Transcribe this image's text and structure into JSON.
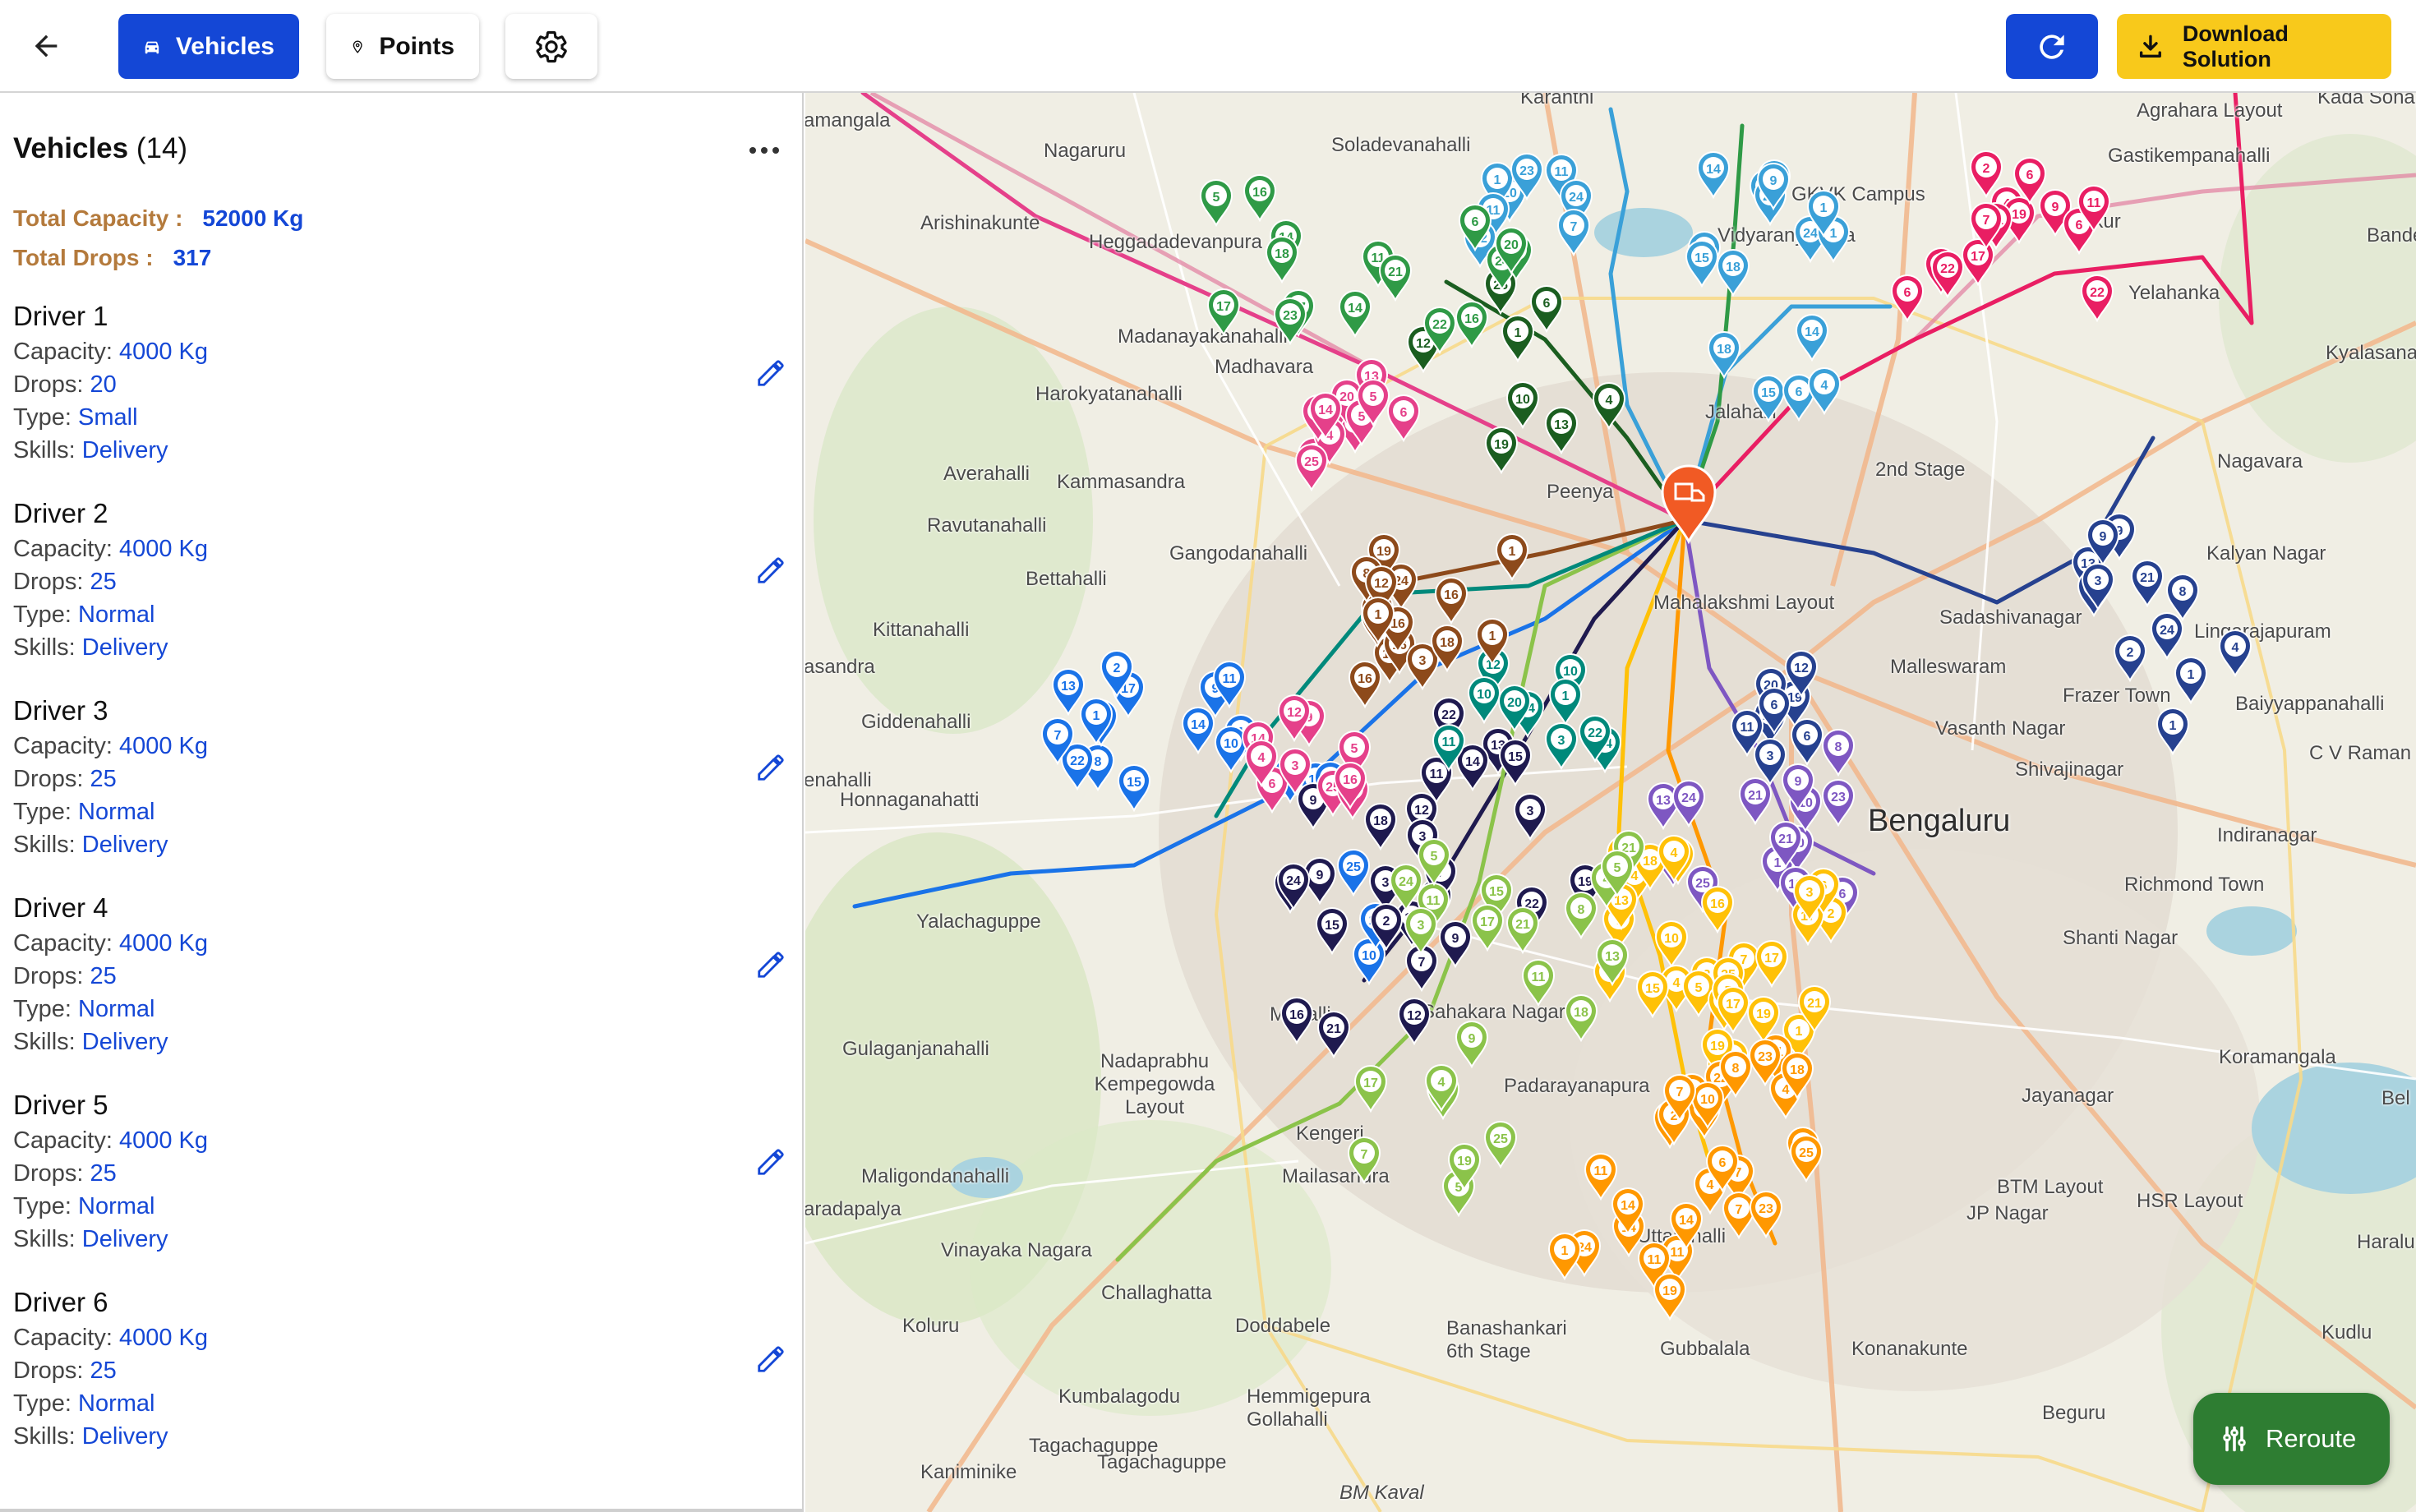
{
  "header": {
    "tabs": [
      {
        "label": "Vehicles",
        "active": true
      },
      {
        "label": "Points",
        "active": false
      }
    ],
    "download_label": "Download Solution"
  },
  "sidebar": {
    "title": "Vehicles",
    "count": "(14)",
    "total_capacity_label": "Total Capacity :",
    "total_capacity_value": "52000 Kg",
    "total_drops_label": "Total Drops :",
    "total_drops_value": "317",
    "field_labels": {
      "capacity": "Capacity: ",
      "drops": "Drops: ",
      "type": "Type: ",
      "skills": "Skills: "
    },
    "drivers": [
      {
        "name": "Driver 1",
        "capacity": "4000 Kg",
        "drops": "20",
        "type": "Small",
        "skills": "Delivery"
      },
      {
        "name": "Driver 2",
        "capacity": "4000 Kg",
        "drops": "25",
        "type": "Normal",
        "skills": "Delivery"
      },
      {
        "name": "Driver 3",
        "capacity": "4000 Kg",
        "drops": "25",
        "type": "Normal",
        "skills": "Delivery"
      },
      {
        "name": "Driver 4",
        "capacity": "4000 Kg",
        "drops": "25",
        "type": "Normal",
        "skills": "Delivery"
      },
      {
        "name": "Driver 5",
        "capacity": "4000 Kg",
        "drops": "25",
        "type": "Normal",
        "skills": "Delivery"
      },
      {
        "name": "Driver 6",
        "capacity": "4000 Kg",
        "drops": "25",
        "type": "Normal",
        "skills": "Delivery"
      }
    ]
  },
  "map": {
    "places": [
      "amangala",
      "Nagaruru",
      "Soladevanahalli",
      "Karanthi",
      "Agrahara Layout",
      "Kada Sonappa Halli",
      "Arishinakunte",
      "Heggadadevanpura",
      "GKVK Campus",
      "Gastikempanahalli",
      "Vidyaranyapura",
      "Jakkur",
      "Bande",
      "Madanayakanahalli",
      "Madhavara",
      "Yelahanka",
      "Harokyatanahalli",
      "Kyalasanahalli",
      "Jalahalli",
      "Averahalli",
      "Kammasandra",
      "2nd Stage",
      "Nagavara",
      "Peenya",
      "Ravutanahalli",
      "Gangodanahalli",
      "Kalyan Nagar",
      "Bettahalli",
      "Mahalakshmi Layout",
      "Sadashivanagar",
      "Lingarajapuram",
      "Kittanahalli",
      "Malleswaram",
      "asandra",
      "Frazer Town",
      "Baiyyappanahalli",
      "Giddenahalli",
      "Vasanth Nagar",
      "Shivajinagar",
      "C V Raman Nagar",
      "enahalli",
      "Honnaganahatti",
      "Bengaluru",
      "Indiranagar",
      "Yalachaguppe",
      "Richmond Town",
      "Shanti Nagar",
      "Gulaganjanahalli",
      "Nadaprabhu Kempegowda Layout",
      "Shivajinagar",
      "Koramangala",
      "Jayanagar",
      "Kengeri",
      "Mailasandra",
      "Maligondanahalli",
      "BTM Layout",
      "HSR Layout",
      "JP Nagar",
      "aradapalya",
      "Vinayaka Nagara",
      "Uttarahalli",
      "Haralur",
      "Challaghatta",
      "Doddabele",
      "Banashankari 6th Stage",
      "Koluru",
      "Gubbalala",
      "Konanakunte",
      "Kudlu",
      "Kumbalagodu",
      "Hemmigepura Gollahalli",
      "Beguru",
      "Tagachaguppe",
      "Kaniminike",
      "BM Kaval",
      "Tagachaguppe",
      "Mavalli",
      "Sahakara Nagar",
      "Padarayanapura",
      "Bel"
    ],
    "drivers": [
      {
        "color": "#e5408a"
      },
      {
        "color": "#3aa0d8"
      },
      {
        "color": "#2f9a46"
      },
      {
        "color": "#8bc34a"
      },
      {
        "color": "#1a73e8"
      },
      {
        "color": "#1f1a4f"
      },
      {
        "color": "#26418f"
      },
      {
        "color": "#00897b"
      },
      {
        "color": "#8d4a1b"
      },
      {
        "color": "#7e57c2"
      },
      {
        "color": "#ffc107"
      },
      {
        "color": "#ff9800"
      },
      {
        "color": "#e91e63"
      },
      {
        "color": "#1b5e20"
      }
    ],
    "depot_color": "#f15a24"
  },
  "reroute_label": "Reroute",
  "colors": {
    "primary": "#1447d6",
    "accent": "#f8c91b",
    "summary_label": "#b47a3c",
    "reroute": "#2e7d32"
  }
}
